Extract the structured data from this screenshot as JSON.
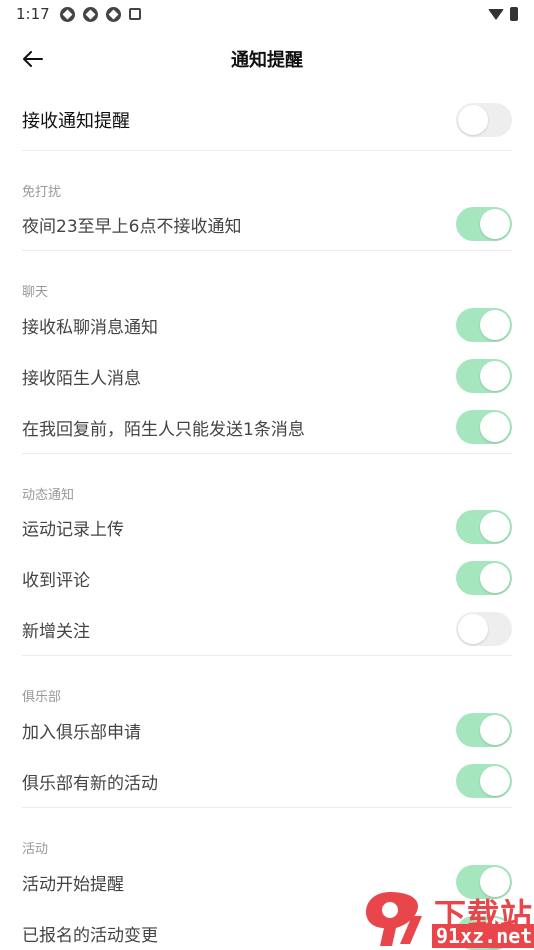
{
  "status_bar": {
    "time": "1:17"
  },
  "header": {
    "title": "通知提醒",
    "back_icon": "arrow-left-icon"
  },
  "master": {
    "label": "接收通知提醒",
    "on": false
  },
  "sections": [
    {
      "title": "免打扰",
      "items": [
        {
          "label": "夜间23至早上6点不接收通知",
          "on": true
        }
      ]
    },
    {
      "title": "聊天",
      "items": [
        {
          "label": "接收私聊消息通知",
          "on": true
        },
        {
          "label": "接收陌生人消息",
          "on": true
        },
        {
          "label": "在我回复前，陌生人只能发送1条消息",
          "on": true
        }
      ]
    },
    {
      "title": "动态通知",
      "items": [
        {
          "label": "运动记录上传",
          "on": true
        },
        {
          "label": "收到评论",
          "on": true
        },
        {
          "label": "新增关注",
          "on": false
        }
      ]
    },
    {
      "title": "俱乐部",
      "items": [
        {
          "label": "加入俱乐部申请",
          "on": true
        },
        {
          "label": "俱乐部有新的活动",
          "on": true
        }
      ]
    },
    {
      "title": "活动",
      "items": [
        {
          "label": "活动开始提醒",
          "on": true
        },
        {
          "label": "已报名的活动变更",
          "on": true
        }
      ]
    }
  ],
  "watermark": {
    "top": "下载站",
    "bottom": "91xz.net"
  },
  "colors": {
    "toggle_on": "#a5e6be",
    "toggle_off": "#eeeeee",
    "watermark": "#e8464b"
  }
}
